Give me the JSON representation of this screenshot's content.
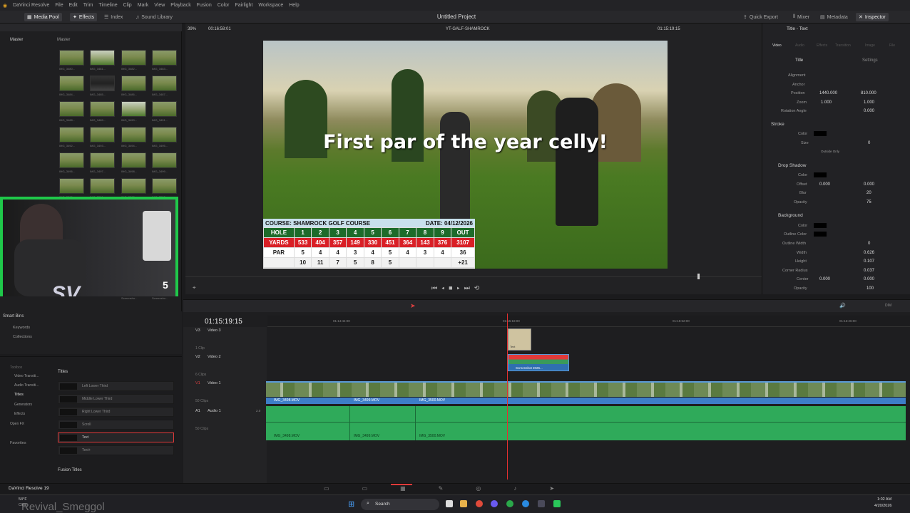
{
  "app": {
    "name": "DaVinci Resolve",
    "menus": [
      "File",
      "Edit",
      "Trim",
      "Timeline",
      "Clip",
      "Mark",
      "View",
      "Playback",
      "Fusion",
      "Color",
      "Fairlight",
      "Workspace",
      "Help"
    ],
    "project_title": "Untitled Project"
  },
  "toolbar": {
    "media_pool": "Media Pool",
    "effects": "Effects",
    "index": "Index",
    "sound_library": "Sound Library",
    "quick_export": "Quick Export",
    "mixer": "Mixer",
    "metadata": "Metadata",
    "inspector": "Inspector"
  },
  "viewer": {
    "zoom": "39%",
    "timecode": "00:16:58:01",
    "clip_name": "YT-GALF-SHAMROCK",
    "right_timecode": "01:15:19:15",
    "caption": "First par of the year celly!"
  },
  "media": {
    "tabs": [
      "Master",
      "Master"
    ],
    "thumb_labels": [
      "IMG_3480...",
      "IMG_3481...",
      "IMG_3482...",
      "IMG_3483...",
      "IMG_3484...",
      "IMG_3485...",
      "IMG_3486...",
      "IMG_3487...",
      "IMG_3488...",
      "IMG_3489...",
      "IMG_3490...",
      "IMG_3491...",
      "IMG_3492...",
      "IMG_3493...",
      "IMG_3494...",
      "IMG_3495...",
      "IMG_3496...",
      "IMG_3497...",
      "IMG_3498...",
      "IMG_3499...",
      "IMG_3500...",
      "IMG_3501...",
      "IMG_3502...",
      "IMG_3503..."
    ],
    "bottom_labels": [
      "YT-GALF-SH...",
      "Screensho...",
      "Screensho..."
    ],
    "counter": "5"
  },
  "scorecard": {
    "course": "COURSE: SHAMROCK GOLF COURSE",
    "date": "DATE: 04/12/2026",
    "hole": [
      "HOLE",
      "1",
      "2",
      "3",
      "4",
      "5",
      "6",
      "7",
      "8",
      "9",
      "OUT"
    ],
    "yards": [
      "YARDS",
      "533",
      "404",
      "357",
      "149",
      "330",
      "451",
      "364",
      "143",
      "376",
      "3107"
    ],
    "par": [
      "PAR",
      "5",
      "4",
      "4",
      "3",
      "4",
      "5",
      "4",
      "3",
      "4",
      "36"
    ],
    "score": [
      "",
      "10",
      "11",
      "7",
      "5",
      "8",
      "5",
      "",
      "",
      "",
      "+21"
    ]
  },
  "inspector": {
    "title": "Title - Text",
    "tabs": [
      "Video",
      "Audio",
      "Effects",
      "Transition",
      "Image",
      "File"
    ],
    "subtabs": [
      "Title",
      "Settings"
    ],
    "props": {
      "alignment": "Alignment",
      "anchor": "Anchor",
      "position": "Position",
      "pos_x": "1440.000",
      "pos_y": "810.000",
      "zoom": "Zoom",
      "zoom_x": "1.000",
      "zoom_y": "1.000",
      "rotation": "Rotation Angle",
      "rotation_val": "0.000",
      "stroke": "Stroke",
      "color": "Color",
      "size": "Size",
      "size_val": "0",
      "outside_only": "Outside Only",
      "drop_shadow": "Drop Shadow",
      "offset": "Offset",
      "offset_x": "0.000",
      "offset_y": "0.000",
      "blur": "Blur",
      "blur_val": "20",
      "opacity": "Opacity",
      "opacity_val": "75",
      "background": "Background",
      "outline_color": "Outline Color",
      "outline_width": "Outline Width",
      "outline_width_val": "0",
      "width": "Width",
      "width_val": "0.626",
      "height": "Height",
      "height_val": "0.107",
      "corner_radius": "Corner Radius",
      "corner_radius_val": "0.037",
      "center": "Center",
      "center_x": "0.000",
      "center_y": "0.000",
      "bg_opacity_val": "100"
    }
  },
  "timeline": {
    "timecode": "01:15:19:15",
    "ruler": [
      "01:14:44:00",
      "01:15:18:00",
      "01:15:52:00",
      "01:16:26:00"
    ],
    "tracks": [
      {
        "id": "V3",
        "name": "Video 3",
        "clips": "1 Clip"
      },
      {
        "id": "V2",
        "name": "Video 2",
        "clips": "6 Clips"
      },
      {
        "id": "V1",
        "name": "Video 1",
        "clips": "50 Clips"
      },
      {
        "id": "A1",
        "name": "Audio 1",
        "clips": "50 Clips",
        "level": "2.0"
      }
    ],
    "clip_names": [
      "IMG_3498.MOV",
      "IMG_3499.MOV",
      "IMG_3500.MOV"
    ],
    "title_clip": "Text",
    "screenshot_clip": "Screenshot 2026...",
    "dim": "DIM"
  },
  "effects": {
    "smart_bins": "Smart Bins",
    "keywords": "Keywords",
    "collections": "Collections",
    "toolbox": "Toolbox",
    "categories": [
      "Video Transiti...",
      "Audio Transiti...",
      "Titles",
      "Generators",
      "Effects"
    ],
    "openfx": "Open FX",
    "favorites": "Favorites",
    "titles_header": "Titles",
    "items": [
      "Left Lower Third",
      "Middle Lower Third",
      "Right Lower Third",
      "Scroll",
      "Text",
      "Text+"
    ],
    "fusion_titles": "Fusion Titles"
  },
  "taskbar": {
    "app_name": "DaVinci Resolve 19",
    "weather_temp": "54°F",
    "weather": "Clear",
    "search": "Search",
    "time": "1:02 AM",
    "date": "4/20/2026"
  },
  "overlay": {
    "watermark": "Revival_Smeggol"
  }
}
